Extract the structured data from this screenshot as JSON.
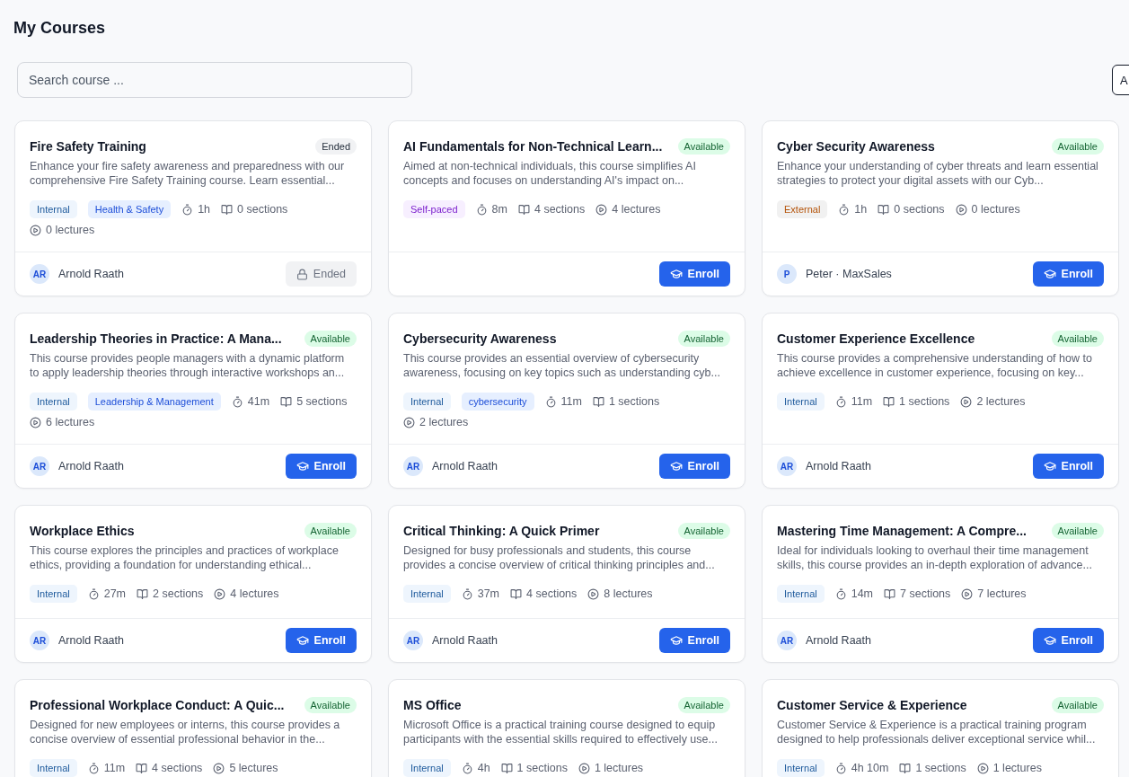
{
  "page_title": "My Courses",
  "search": {
    "placeholder": "Search course ..."
  },
  "toolbar_button": {
    "label": "A"
  },
  "courses": [
    {
      "title": "Fire Safety Training",
      "status": {
        "kind": "ended",
        "label": "Ended"
      },
      "description": "Enhance your fire safety awareness and preparedness with our comprehensive Fire Safety Training course. Learn essential...",
      "tags": [
        {
          "kind": "internal",
          "label": "Internal"
        },
        {
          "kind": "category",
          "label": "Health & Safety"
        }
      ],
      "duration": "1h",
      "sections": "0 sections",
      "lectures": "0 lectures",
      "instructor": {
        "initials": "AR",
        "name": "Arnold Raath"
      },
      "action": {
        "kind": "ended",
        "label": "Ended"
      }
    },
    {
      "title": "AI Fundamentals for Non-Technical Learn...",
      "status": {
        "kind": "available",
        "label": "Available"
      },
      "description": "Aimed at non-technical individuals, this course simplifies AI concepts and focuses on understanding AI's impact on...",
      "tags": [
        {
          "kind": "self-paced",
          "label": "Self-paced"
        }
      ],
      "duration": "8m",
      "sections": "4 sections",
      "lectures": "4 lectures",
      "action": {
        "kind": "enroll",
        "label": "Enroll"
      }
    },
    {
      "title": "Cyber Security Awareness",
      "status": {
        "kind": "available",
        "label": "Available"
      },
      "description": "Enhance your understanding of cyber threats and learn essential strategies to protect your digital assets with our Cyb...",
      "tags": [
        {
          "kind": "external",
          "label": "External"
        }
      ],
      "duration": "1h",
      "sections": "0 sections",
      "lectures": "0 lectures",
      "instructor": {
        "initials": "P",
        "name": "Peter · MaxSales"
      },
      "action": {
        "kind": "enroll",
        "label": "Enroll"
      }
    },
    {
      "title": "Leadership Theories in Practice: A Mana...",
      "status": {
        "kind": "available",
        "label": "Available"
      },
      "description": "This course provides people managers with a dynamic platform to apply leadership theories through interactive workshops an...",
      "tags": [
        {
          "kind": "internal",
          "label": "Internal"
        },
        {
          "kind": "category",
          "label": "Leadership & Management"
        }
      ],
      "duration": "41m",
      "sections": "5 sections",
      "lectures": "6 lectures",
      "instructor": {
        "initials": "AR",
        "name": "Arnold Raath"
      },
      "action": {
        "kind": "enroll",
        "label": "Enroll"
      }
    },
    {
      "title": "Cybersecurity Awareness",
      "status": {
        "kind": "available",
        "label": "Available"
      },
      "description": "This course provides an essential overview of cybersecurity awareness, focusing on key topics such as understanding cyb...",
      "tags": [
        {
          "kind": "internal",
          "label": "Internal"
        },
        {
          "kind": "category",
          "label": "cybersecurity"
        }
      ],
      "duration": "11m",
      "sections": "1 sections",
      "lectures": "2 lectures",
      "instructor": {
        "initials": "AR",
        "name": "Arnold Raath"
      },
      "action": {
        "kind": "enroll",
        "label": "Enroll"
      }
    },
    {
      "title": "Customer Experience Excellence",
      "status": {
        "kind": "available",
        "label": "Available"
      },
      "description": "This course provides a comprehensive understanding of how to achieve excellence in customer experience, focusing on key...",
      "tags": [
        {
          "kind": "internal",
          "label": "Internal"
        }
      ],
      "duration": "11m",
      "sections": "1 sections",
      "lectures": "2 lectures",
      "instructor": {
        "initials": "AR",
        "name": "Arnold Raath"
      },
      "action": {
        "kind": "enroll",
        "label": "Enroll"
      }
    },
    {
      "title": "Workplace Ethics",
      "status": {
        "kind": "available",
        "label": "Available"
      },
      "description": "This course explores the principles and practices of workplace ethics, providing a foundation for understanding ethical...",
      "tags": [
        {
          "kind": "internal",
          "label": "Internal"
        }
      ],
      "duration": "27m",
      "sections": "2 sections",
      "lectures": "4 lectures",
      "instructor": {
        "initials": "AR",
        "name": "Arnold Raath"
      },
      "action": {
        "kind": "enroll",
        "label": "Enroll"
      }
    },
    {
      "title": "Critical Thinking: A Quick Primer",
      "status": {
        "kind": "available",
        "label": "Available"
      },
      "description": "Designed for busy professionals and students, this course provides a concise overview of critical thinking principles and...",
      "tags": [
        {
          "kind": "internal",
          "label": "Internal"
        }
      ],
      "duration": "37m",
      "sections": "4 sections",
      "lectures": "8 lectures",
      "instructor": {
        "initials": "AR",
        "name": "Arnold Raath"
      },
      "action": {
        "kind": "enroll",
        "label": "Enroll"
      }
    },
    {
      "title": "Mastering Time Management: A Compre...",
      "status": {
        "kind": "available",
        "label": "Available"
      },
      "description": "Ideal for individuals looking to overhaul their time management skills, this course provides an in-depth exploration of advance...",
      "tags": [
        {
          "kind": "internal",
          "label": "Internal"
        }
      ],
      "duration": "14m",
      "sections": "7 sections",
      "lectures": "7 lectures",
      "instructor": {
        "initials": "AR",
        "name": "Arnold Raath"
      },
      "action": {
        "kind": "enroll",
        "label": "Enroll"
      }
    },
    {
      "title": "Professional Workplace Conduct: A Quic...",
      "status": {
        "kind": "available",
        "label": "Available"
      },
      "description": "Designed for new employees or interns, this course provides a concise overview of essential professional behavior in the...",
      "tags": [
        {
          "kind": "internal",
          "label": "Internal"
        }
      ],
      "duration": "11m",
      "sections": "4 sections",
      "lectures": "5 lectures"
    },
    {
      "title": "MS Office",
      "status": {
        "kind": "available",
        "label": "Available"
      },
      "description": "Microsoft Office is a practical training course designed to equip participants with the essential skills required to effectively use...",
      "tags": [
        {
          "kind": "internal",
          "label": "Internal"
        }
      ],
      "duration": "4h",
      "sections": "1 sections",
      "lectures": "1 lectures"
    },
    {
      "title": "Customer Service & Experience",
      "status": {
        "kind": "available",
        "label": "Available"
      },
      "description": "Customer Service & Experience is a practical training program designed to help professionals deliver exceptional service whil...",
      "tags": [
        {
          "kind": "internal",
          "label": "Internal"
        }
      ],
      "duration": "4h 10m",
      "sections": "1 sections",
      "lectures": "1 lectures"
    }
  ]
}
